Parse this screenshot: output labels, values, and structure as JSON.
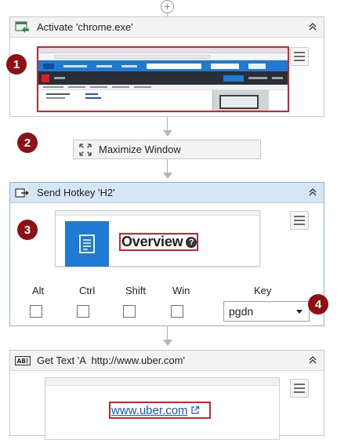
{
  "workflow": {
    "activate": {
      "title": "Activate 'chrome.exe'"
    },
    "maximize": {
      "title": "Maximize Window"
    },
    "hotkey": {
      "title": "Send Hotkey 'H2'",
      "preview_text": "Overview",
      "modifiers": [
        "Alt",
        "Ctrl",
        "Shift",
        "Win"
      ],
      "key_label": "Key",
      "key_value": "pgdn"
    },
    "gettext": {
      "title": "Get Text 'A  http://www.uber.com'",
      "preview_link": "www.uber.com"
    }
  },
  "badges": [
    "1",
    "2",
    "3",
    "4"
  ],
  "colors": {
    "badge": "#8b1115",
    "selected_header": "#d6e6f5",
    "highlight_border": "#d3242b",
    "link": "#1a55c8",
    "tile_blue": "#1f7ad4"
  },
  "icons": {
    "add": "plus-circle-icon",
    "activate": "activate-window-icon",
    "maximize": "maximize-icon",
    "hotkey": "keyboard-arrow-icon",
    "gettext": "text-field-icon",
    "collapse": "double-chevron-up-icon",
    "menu": "hamburger-menu-icon",
    "help": "question-circle-icon",
    "external": "external-link-icon",
    "document": "document-icon"
  }
}
